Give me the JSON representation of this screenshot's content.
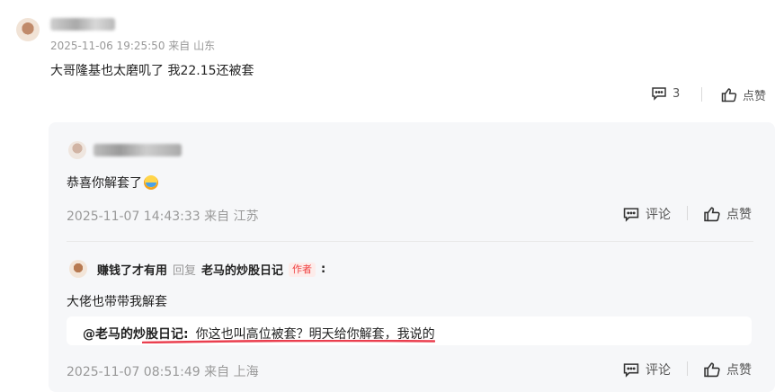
{
  "main_comment": {
    "meta": "2025-11-06 19:25:50   来自 山东",
    "text": "大哥隆基也太磨叽了 我22.15还被套",
    "reply_count": "3",
    "like_label": "点赞"
  },
  "replies": [
    {
      "text": "恭喜你解套了",
      "meta": "2025-11-07 14:43:33   来自 江苏",
      "comment_label": "评论",
      "like_label": "点赞"
    },
    {
      "username": "赚钱了才有用",
      "reply_word": "回复",
      "target_user": "老马的炒股日记",
      "author_badge": "作者",
      "colon": ":",
      "text": "大佬也带带我解套",
      "quote": {
        "mention": "@老马的炒股日记:",
        "text": "你这也叫高位被套？明天给你解套，我说的"
      },
      "meta": "2025-11-07 08:51:49   来自 上海",
      "comment_label": "评论",
      "like_label": "点赞"
    }
  ],
  "colors": {
    "panel_bg": "#f6f7f9",
    "accent_red": "#f04142",
    "meta_gray": "#999999"
  }
}
